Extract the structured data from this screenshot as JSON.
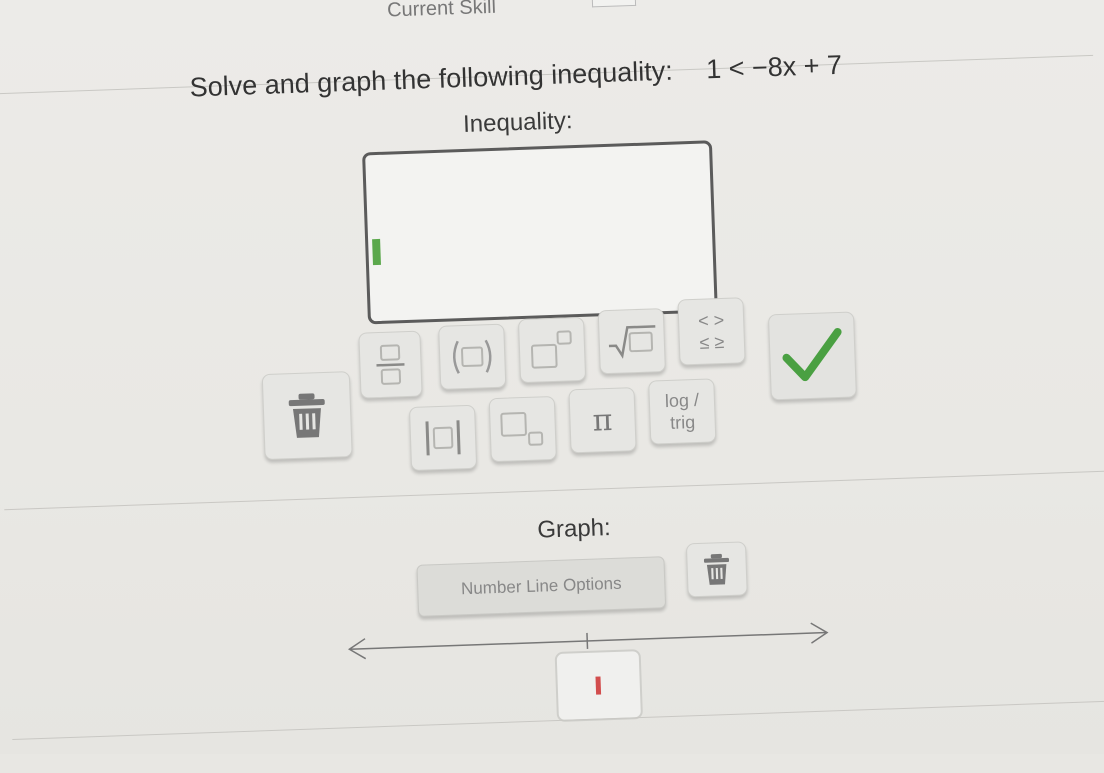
{
  "header": {
    "partial_title": "Current Skill"
  },
  "problem": {
    "prompt": "Solve and graph the following inequality:",
    "expression": "1 < −8x + 7"
  },
  "inequality": {
    "label": "Inequality:",
    "answer_value": ""
  },
  "keypad": {
    "fraction": "fraction",
    "parentheses": "( )",
    "exponent": "exponent",
    "sqrt": "square root",
    "ineq_top": "< >",
    "ineq_bottom": "≤ ≥",
    "abs_value": "| |",
    "subscript": "subscript",
    "pi": "π",
    "log_line1": "log /",
    "log_line2": "trig"
  },
  "graph": {
    "label": "Graph:",
    "options_label": "Number Line Options"
  },
  "colors": {
    "check": "#4aa042",
    "cursor": "#5ba84c",
    "point": "#d24d4d"
  }
}
